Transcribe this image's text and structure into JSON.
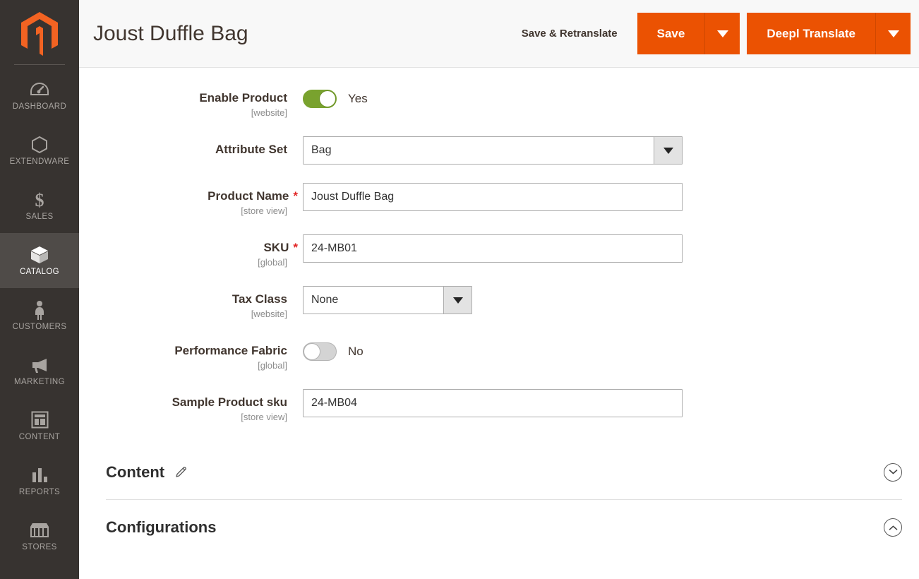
{
  "sidebar": {
    "logo_name": "magento-logo",
    "items": [
      {
        "label": "DASHBOARD",
        "icon": "dashboard-icon",
        "active": false
      },
      {
        "label": "EXTENDWARE",
        "icon": "hexagon-icon",
        "active": false
      },
      {
        "label": "SALES",
        "icon": "dollar-icon",
        "active": false
      },
      {
        "label": "CATALOG",
        "icon": "box-icon",
        "active": true
      },
      {
        "label": "CUSTOMERS",
        "icon": "person-icon",
        "active": false
      },
      {
        "label": "MARKETING",
        "icon": "megaphone-icon",
        "active": false
      },
      {
        "label": "CONTENT",
        "icon": "layout-icon",
        "active": false
      },
      {
        "label": "REPORTS",
        "icon": "bar-chart-icon",
        "active": false
      },
      {
        "label": "STORES",
        "icon": "storefront-icon",
        "active": false
      }
    ]
  },
  "header": {
    "title": "Joust Duffle Bag",
    "save_retranslate_label": "Save & Retranslate",
    "save_label": "Save",
    "deepl_label": "Deepl Translate",
    "accent_color": "#EB5202"
  },
  "form": {
    "enable_product": {
      "label": "Enable Product",
      "scope": "[website]",
      "value_text": "Yes",
      "on": true
    },
    "attribute_set": {
      "label": "Attribute Set",
      "scope": "",
      "value": "Bag"
    },
    "product_name": {
      "label": "Product Name",
      "scope": "[store view]",
      "required": "*",
      "value": "Joust Duffle Bag"
    },
    "sku": {
      "label": "SKU",
      "scope": "[global]",
      "required": "*",
      "value": "24-MB01"
    },
    "tax_class": {
      "label": "Tax Class",
      "scope": "[website]",
      "value": "None"
    },
    "performance_fabric": {
      "label": "Performance Fabric",
      "scope": "[global]",
      "value_text": "No",
      "on": false
    },
    "sample_product_sku": {
      "label": "Sample Product sku",
      "scope": "[store view]",
      "value": "24-MB04"
    }
  },
  "sections": [
    {
      "title": "Content",
      "expanded": false,
      "has_edit_icon": true
    },
    {
      "title": "Configurations",
      "expanded": true,
      "has_edit_icon": false
    }
  ]
}
